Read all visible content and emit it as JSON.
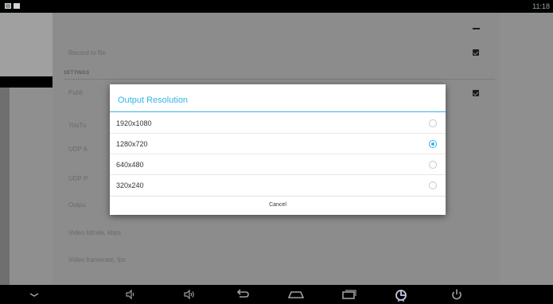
{
  "status_bar": {
    "time": "11:18",
    "icons": [
      "screen-icon",
      "sd-card-icon"
    ]
  },
  "settings": {
    "rows": [
      {
        "label": "Record to file",
        "control": "checkbox",
        "checked": true
      }
    ],
    "section_header": "SETTINGS",
    "rows_below": [
      {
        "label": "Publi",
        "control": "checkbox",
        "checked": true
      },
      {
        "label": "YouTu"
      },
      {
        "label": "UDP A"
      },
      {
        "label": "UDP P"
      },
      {
        "label": "Outpu"
      },
      {
        "label": "Video bitrate, kbps"
      },
      {
        "label": "Video framerate, fps"
      }
    ]
  },
  "dialog": {
    "title": "Output Resolution",
    "options": [
      {
        "label": "1920x1080",
        "selected": false
      },
      {
        "label": "1280x720",
        "selected": true
      },
      {
        "label": "640x480",
        "selected": false
      },
      {
        "label": "320x240",
        "selected": false
      }
    ],
    "cancel_label": "Cancel"
  },
  "nav_bar": {
    "icons": [
      "hide-keyboard-icon",
      "volume-down-icon",
      "volume-up-icon",
      "back-icon",
      "home-icon",
      "recent-apps-icon",
      "screenshot-icon",
      "power-icon"
    ]
  },
  "colors": {
    "accent": "#33b5e5",
    "dim_background": "#8c8c8c",
    "bar_background": "#000000"
  }
}
